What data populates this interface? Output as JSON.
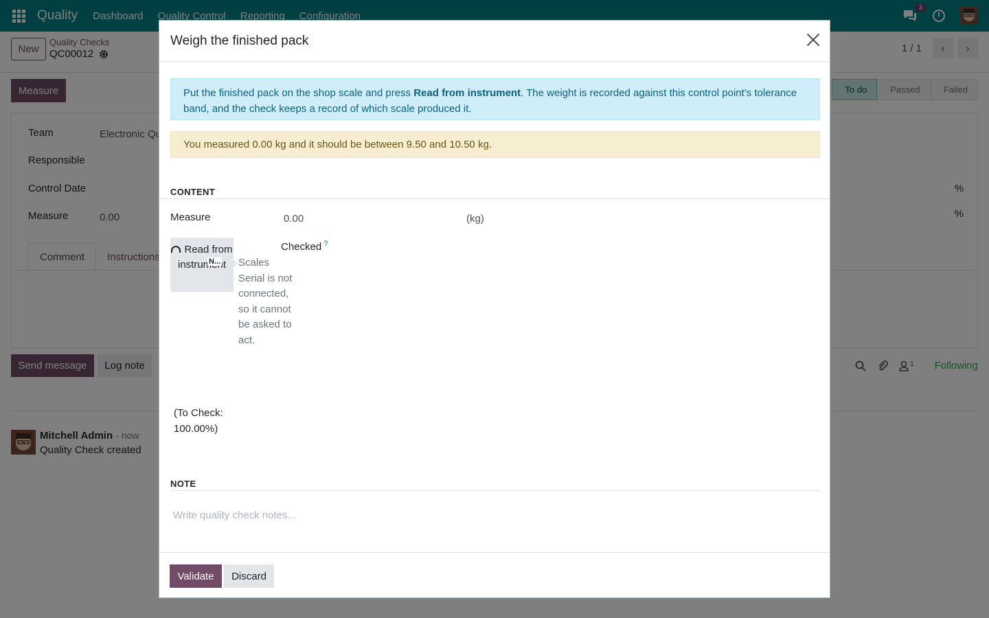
{
  "topbar": {
    "app_name": "Quality",
    "menu": [
      "Dashboard",
      "Quality Control",
      "Reporting",
      "Configuration"
    ],
    "chat_count": "3"
  },
  "control_panel": {
    "new_label": "New",
    "breadcrumb_parent": "Quality Checks",
    "breadcrumb_current": "QC00012",
    "pager": "1 / 1"
  },
  "form": {
    "measure_button": "Measure",
    "statuses": [
      "To do",
      "Passed",
      "Failed"
    ],
    "active_status": "To do",
    "fields": {
      "team_label": "Team",
      "team_value": "Electronic Qu",
      "responsible_label": "Responsible",
      "control_date_label": "Control Date",
      "measure_label": "Measure",
      "measure_value": "0.00",
      "pct_symbol": "%"
    },
    "tabs": [
      "Comment",
      "Instructions"
    ]
  },
  "chatter": {
    "send_message": "Send message",
    "log_note": "Log note",
    "followers_count": "1",
    "following": "Following",
    "message": {
      "author": "Mitchell Admin",
      "time": "- now",
      "body": "Quality Check created"
    }
  },
  "modal": {
    "title": "Weigh the finished pack",
    "info_text_before": "Put the finished pack on the shop scale and press ",
    "info_text_bold": "Read from instrument",
    "info_text_after": ". The weight is recorded against this control point's tolerance band, and the check keeps a record of which scale produced it.",
    "warning_text": "You measured 0.00 kg and it should be between 9.50 and 10.50 kg.",
    "content_heading": "CONTENT",
    "measure_label": "Measure",
    "measure_value": "0.00",
    "measure_unit": "(kg)",
    "checked_label": "Checked",
    "help_mark": "?",
    "read_button": "Read from instrument",
    "tooltip_title": "N...",
    "tooltip_text": "Scales Serial is not connected, so it cannot be asked to act.",
    "to_check_text": "(To Check: 100.00%)",
    "note_heading": "NOTE",
    "note_placeholder": "Write quality check notes...",
    "validate_label": "Validate",
    "discard_label": "Discard"
  }
}
